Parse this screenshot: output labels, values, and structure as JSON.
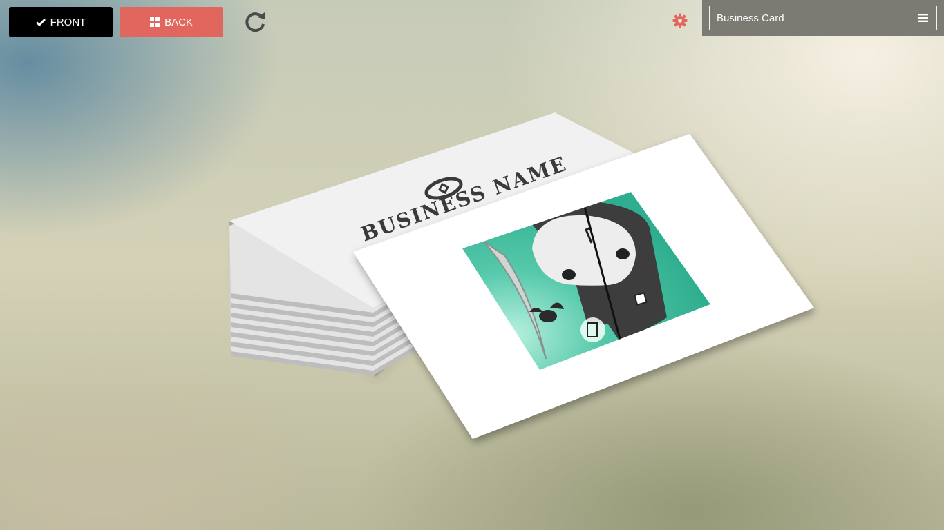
{
  "toolbar": {
    "front_label": "FRONT",
    "back_label": "BACK",
    "selected_side": "front"
  },
  "product_select": {
    "value": "Business Card"
  },
  "card_back": {
    "business_name": "BUSINESS NAME"
  },
  "colors": {
    "front_button": "#000000",
    "back_button": "#e0665e",
    "gear": "#e0665e",
    "panel": "#7b7a73",
    "illustration_teal": "#3fbfa0"
  },
  "icons": {
    "front_button": "check-icon",
    "back_button": "grid-icon",
    "rotate": "refresh-icon",
    "settings": "gear-icon",
    "menu": "hamburger-icon"
  }
}
